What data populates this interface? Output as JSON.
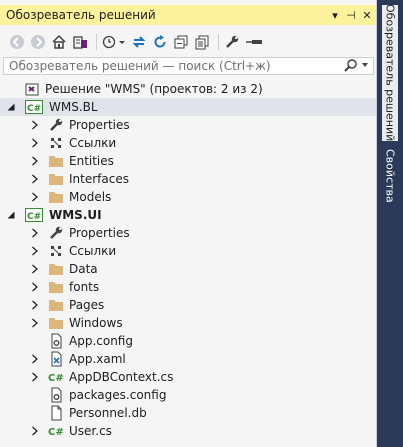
{
  "panel": {
    "title": "Обозреватель решений",
    "title_buttons": [
      "▾",
      "⊣",
      "✕"
    ]
  },
  "toolbar": {
    "icons": [
      "back-icon",
      "forward-icon",
      "home-icon",
      "switch-views-icon",
      "history-icon",
      "sync-icon",
      "refresh-icon",
      "collapse-all-icon",
      "show-all-files-icon",
      "properties-icon",
      "pin-icon"
    ]
  },
  "search": {
    "placeholder": "Обозреватель решений — поиск (Ctrl+ж)"
  },
  "solution": {
    "label": "Решение \"WMS\" (проектов: 2 из 2)"
  },
  "projects": [
    {
      "name": "WMS.BL",
      "items": [
        {
          "label": "Properties",
          "icon": "wrench-icon",
          "expandable": true
        },
        {
          "label": "Ссылки",
          "icon": "references-icon",
          "expandable": true
        },
        {
          "label": "Entities",
          "icon": "folder-icon",
          "expandable": true
        },
        {
          "label": "Interfaces",
          "icon": "folder-icon",
          "expandable": true
        },
        {
          "label": "Models",
          "icon": "folder-icon",
          "expandable": true
        }
      ]
    },
    {
      "name": "WMS.UI",
      "items": [
        {
          "label": "Properties",
          "icon": "wrench-icon",
          "expandable": true
        },
        {
          "label": "Ссылки",
          "icon": "references-icon",
          "expandable": true
        },
        {
          "label": "Data",
          "icon": "folder-icon",
          "expandable": true
        },
        {
          "label": "fonts",
          "icon": "folder-icon",
          "expandable": true
        },
        {
          "label": "Pages",
          "icon": "folder-icon",
          "expandable": true
        },
        {
          "label": "Windows",
          "icon": "folder-icon",
          "expandable": true
        },
        {
          "label": "App.config",
          "icon": "config-file-icon",
          "expandable": false
        },
        {
          "label": "App.xaml",
          "icon": "xaml-file-icon",
          "expandable": true
        },
        {
          "label": "AppDBContext.cs",
          "icon": "csharp-file-icon",
          "expandable": true
        },
        {
          "label": "packages.config",
          "icon": "config-file-icon",
          "expandable": false
        },
        {
          "label": "Personnel.db",
          "icon": "file-icon",
          "expandable": false
        },
        {
          "label": "User.cs",
          "icon": "csharp-file-icon",
          "expandable": true
        }
      ]
    }
  ],
  "side_tabs": [
    {
      "label": "Обозреватель решений",
      "active": true
    },
    {
      "label": "Свойства",
      "active": false
    }
  ]
}
